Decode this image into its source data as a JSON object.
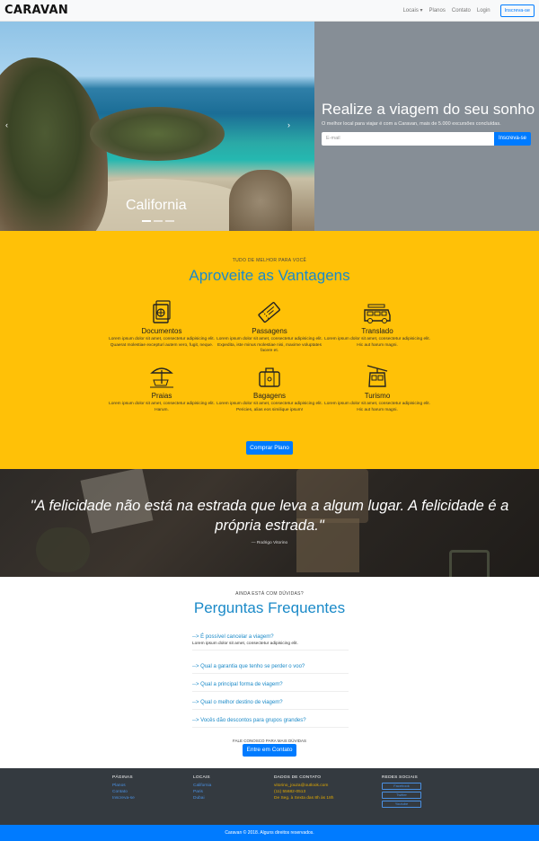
{
  "nav": {
    "brand": "CARAVAN",
    "items": [
      "Locais ▾",
      "Planos",
      "Contato",
      "Login"
    ],
    "cta": "Inscreva-se"
  },
  "hero": {
    "carousel_caption": "California",
    "prev_arrow": "‹",
    "next_arrow": "›",
    "title": "Realize a viagem do seu sonho",
    "subtitle": "O melhor local para viajar é com a Caravan, mais de 5.000 excursões concluídas.",
    "email_placeholder": "E-mail",
    "subscribe_label": "Inscreva-se"
  },
  "advantages": {
    "kicker": "TUDO DE MELHOR PARA VOCÊ",
    "title": "Aproveite as Vantagens",
    "items": [
      {
        "icon": "passport-icon",
        "title": "Documentos",
        "text": "Lorem ipsum dolor sit amet, consectetur adipisicing elit. Quaerat molestiae excepturi autem vero, fugit, neque."
      },
      {
        "icon": "ticket-icon",
        "title": "Passagens",
        "text": "Lorem ipsum dolor sit amet, consectetur adipisicing elit. Expedita, iste minus molestiae nisi, maxime voluptates facere et."
      },
      {
        "icon": "van-icon",
        "title": "Translado",
        "text": "Lorem ipsum dolor sit amet, consectetur adipisicing elit. Hic aut harum magni."
      },
      {
        "icon": "beach-icon",
        "title": "Praias",
        "text": "Lorem ipsum dolor sit amet, consectetur adipisicing elit. Harum."
      },
      {
        "icon": "luggage-icon",
        "title": "Bagagens",
        "text": "Lorem ipsum dolor sit amet, consectetur adipisicing elit. Pericies, alias eos similique ipsum!"
      },
      {
        "icon": "cable-car-icon",
        "title": "Turismo",
        "text": "Lorem ipsum dolor sit amet, consectetur adipisicing elit. Hic aut harum magni."
      }
    ],
    "button": "Comprar Plano"
  },
  "quote": {
    "text": "\"A felicidade não está na estrada que leva a algum lugar. A felicidade é a própria estrada.\"",
    "author": "— Rodrigo Vitorino"
  },
  "faq": {
    "kicker": "AINDA ESTÁ COM DÚVIDAS?",
    "title": "Perguntas Frequentes",
    "items": [
      {
        "q": "--> É possível cancelar a viagem?",
        "a": "Lorem ipsum dolor sit amet, consectetur adipisicing elit."
      },
      {
        "q": "--> Qual a garantia que tenho se perder o voo?",
        "a": ""
      },
      {
        "q": "--> Qual a principal forma de viagem?",
        "a": ""
      },
      {
        "q": "--> Qual o melhor destino de viagem?",
        "a": ""
      },
      {
        "q": "--> Vocês dão descontos para grupos grandes?",
        "a": ""
      }
    ],
    "cta_caption": "FALE CONOSCO PARA MAIS DÚVIDAS",
    "cta_button": "Entre em Contato"
  },
  "footer": {
    "pages": {
      "heading": "PÁGINAS",
      "links": [
        "Planos",
        "Contato",
        "Inscreva-se"
      ]
    },
    "places": {
      "heading": "LOCAIS",
      "links": [
        "California",
        "Paris",
        "Dubai"
      ]
    },
    "contact": {
      "heading": "DADOS DE CONTATO",
      "email": "vitorino_jouza@outlook.com",
      "phone": "(11) 55682-0513",
      "hours": "De Seg. à Sexta das 8h às 18h"
    },
    "social": {
      "heading": "REDES SOCIAIS",
      "buttons": [
        "Facebook",
        "Twitter",
        "Youtube"
      ]
    },
    "copyright": "Caravan © 2018. Alguns direitos reservados."
  },
  "colors": {
    "primary": "#007bff",
    "accent_yellow": "#ffc107",
    "heading_blue": "#1b8ac8",
    "footer_dark": "#343a40",
    "hero_gray": "#868e96"
  }
}
